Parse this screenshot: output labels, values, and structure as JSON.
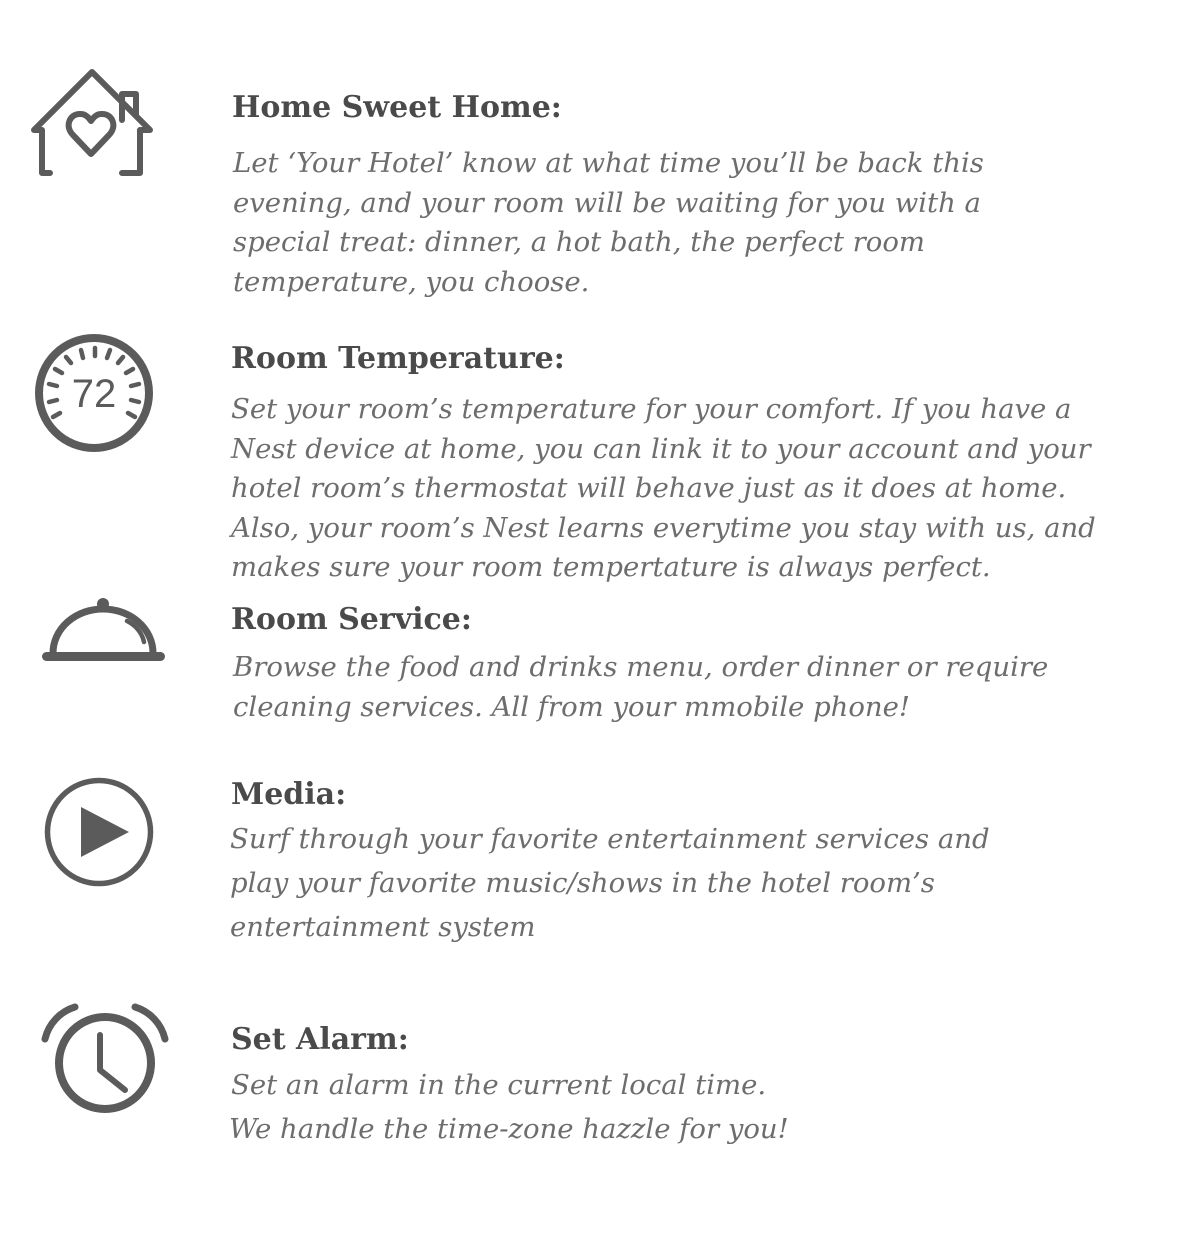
{
  "colors": {
    "icon": "#5b5b5b",
    "title": "#4a4a4a",
    "text": "#6d6d6d",
    "background": "#ffffff"
  },
  "features": [
    {
      "icon": "house-heart-icon",
      "title": "Home Sweet Home:",
      "lines": [
        "Let ‘Your Hotel’ know  at what time you’ll be back this",
        "evening, and your room  will be waiting for you with a",
        "special treat: dinner, a hot bath, the perfect room",
        "temperature, you choose."
      ]
    },
    {
      "icon": "thermostat-icon",
      "icon_text": "72",
      "title": "Room Temperature:",
      "lines": [
        "Set your room’s temperature for your comfort. If you have a",
        "Nest device at home, you can link it to your account and your",
        "hotel room’s thermostat will behave just as it does at home.",
        "Also, your room’s Nest learns everytime you stay with us, and",
        "makes sure your room tempertature is always perfect."
      ]
    },
    {
      "icon": "cloche-icon",
      "title": "Room Service:",
      "lines": [
        "Browse the food and drinks menu, order dinner or require",
        "cleaning services. All from your mmobile phone!"
      ]
    },
    {
      "icon": "play-icon",
      "title": "Media:",
      "lines": [
        "Surf through your favorite entertainment services and",
        "play your favorite music/shows in the hotel room’s",
        "entertainment system"
      ]
    },
    {
      "icon": "alarm-clock-icon",
      "title": "Set Alarm:",
      "lines": [
        "Set an alarm in the current local time.",
        "We handle the time-zone hazzle for you!"
      ]
    }
  ]
}
